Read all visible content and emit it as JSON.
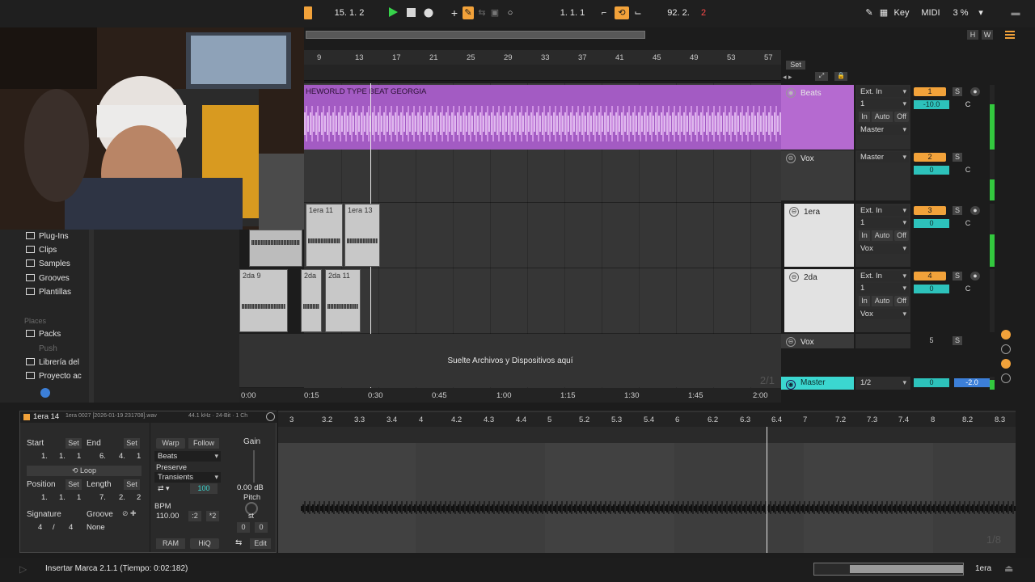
{
  "transport": {
    "position_left": "15.  1.  2",
    "loop_start": "1.  1.  1",
    "loop_length": "92.  2.",
    "loop_length_digit": "2",
    "key_label": "Key",
    "midi_label": "MIDI",
    "cpu": "3 %"
  },
  "overview": {
    "h_label": "H",
    "w_label": "W"
  },
  "arrangement_ruler": [
    "9",
    "13",
    "17",
    "21",
    "25",
    "29",
    "33",
    "37",
    "41",
    "45",
    "49",
    "53",
    "57"
  ],
  "set_label": "Set",
  "beats_clip_title": "HEWORLD TYPE BEAT GEORGIA",
  "tracks": [
    {
      "name": "Beats",
      "input": "Ext. In",
      "channel": "1",
      "output": "Master",
      "number": "1",
      "volume": "-10.0",
      "pan": "C",
      "solo": "S",
      "in": "In",
      "auto": "Auto",
      "off": "Off"
    },
    {
      "name": "Vox",
      "output": "Master",
      "number": "2",
      "volume": "0",
      "pan": "C",
      "solo": "S"
    },
    {
      "name": "1era",
      "input": "Ext. In",
      "channel": "1",
      "output": "Vox",
      "number": "3",
      "volume": "0",
      "pan": "C",
      "solo": "S",
      "in": "In",
      "auto": "Auto",
      "off": "Off"
    },
    {
      "name": "2da",
      "input": "Ext. In",
      "channel": "1",
      "output": "Vox",
      "number": "4",
      "volume": "0",
      "pan": "C",
      "solo": "S",
      "in": "In",
      "auto": "Auto",
      "off": "Off"
    },
    {
      "name": "Vox",
      "volume": "5",
      "solo": "S"
    }
  ],
  "master": {
    "name": "Master",
    "output": "1/2",
    "volume": "0",
    "pan_value": "-2.0"
  },
  "session_clips": {
    "row1": [
      "1era 11",
      "1era 13"
    ],
    "row2": [
      "2da 9",
      "2da",
      "2da 11"
    ]
  },
  "drop_hint": "Suelte Archivos y Dispositivos aquí",
  "time_ruler": [
    "0:00",
    "0:15",
    "0:30",
    "0:45",
    "1:00",
    "1:15",
    "1:30",
    "1:45",
    "2:00"
  ],
  "browser": {
    "items": [
      "Plug-Ins",
      "Clips",
      "Samples",
      "Grooves",
      "Plantillas"
    ],
    "places_header": "Places",
    "places": [
      "Packs",
      "Push",
      "Librería del",
      "Proyecto ac"
    ]
  },
  "clip_view": {
    "clip_name": "1era 14",
    "file_info": "1era 0027 [2026-01-19 231708].wav",
    "format_info": "44.1 kHz · 24-Bit · 1 Ch",
    "start_label": "Start",
    "end_label": "End",
    "set_label": "Set",
    "start_value": [
      "1.",
      "1.",
      "1"
    ],
    "end_value": [
      "6.",
      "4.",
      "1"
    ],
    "loop_label": "Loop",
    "position_label": "Position",
    "length_label": "Length",
    "position_value": [
      "1.",
      "1.",
      "1"
    ],
    "length_value": [
      "7.",
      "2.",
      "2"
    ],
    "signature_label": "Signature",
    "signature": [
      "4",
      "/",
      "4"
    ],
    "groove_label": "Groove",
    "groove_value": "None",
    "warp_label": "Warp",
    "follow_label": "Follow",
    "warp_mode": "Beats",
    "preserve_label": "Preserve",
    "preserve_mode": "Transients",
    "beats_amount": "100",
    "bpm_label": "BPM",
    "bpm_value": "110.00",
    "half_label": ":2",
    "double_label": "*2",
    "gain_label": "Gain",
    "gain_value": "0.00 dB",
    "pitch_label": "Pitch",
    "pitch_st": "st",
    "pitch_values": [
      "0",
      "0"
    ],
    "ram_label": "RAM",
    "hiq_label": "HiQ",
    "edit_label": "Edit"
  },
  "sample_ruler": [
    "3",
    "3.2",
    "3.3",
    "3.4",
    "4",
    "4.2",
    "4.3",
    "4.4",
    "5",
    "5.2",
    "5.3",
    "5.4",
    "6",
    "6.2",
    "6.3",
    "6.4",
    "7",
    "7.2",
    "7.3",
    "7.4",
    "8",
    "8.2",
    "8.3"
  ],
  "sample_zoom_label": "1/8",
  "arrangement_zoom_label": "2/1",
  "status_message": "Insertar Marca 2.1.1 (Tiempo: 0:02:182)",
  "status_track": "1era",
  "colors": {
    "accent_orange": "#f2a23a",
    "beats_purple": "#b56ad0",
    "master_teal": "#3bd7d0",
    "meter_green": "#33c83e"
  }
}
